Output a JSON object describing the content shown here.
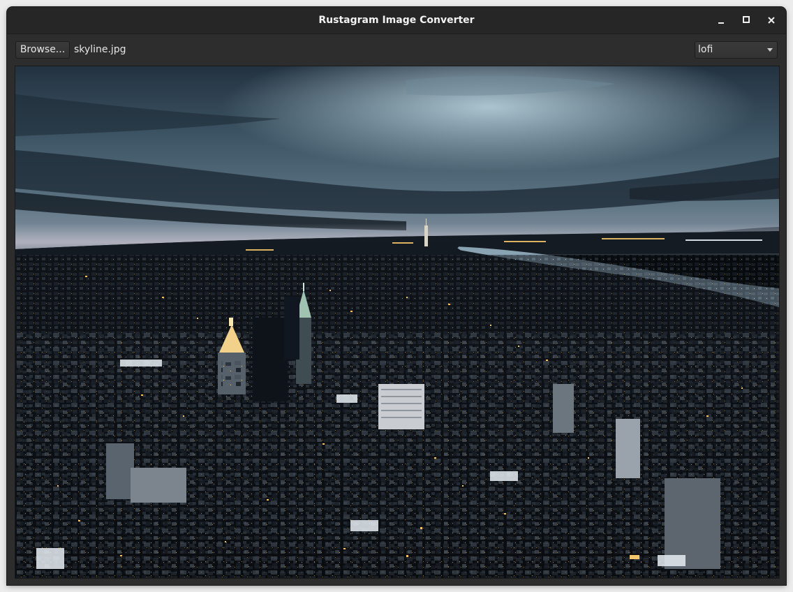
{
  "window": {
    "title": "Rustagram Image Converter"
  },
  "titlebar_buttons": {
    "minimize_icon": "minimize-icon",
    "maximize_icon": "maximize-icon",
    "close_icon": "close-icon"
  },
  "toolbar": {
    "browse_label": "Browse...",
    "filename": "skyline.jpg",
    "filter_selected": "lofi"
  },
  "image": {
    "description_hidden": "",
    "sky_top": "#1c2a36",
    "sky_mid": "#3f5666",
    "sky_light": "#9fb7c4",
    "horizon": "#c9c4cf",
    "water": "#8aa3b3",
    "city_dark": "#0a0c10",
    "light_warm": "#f3c46a",
    "light_white": "#e8eef3"
  }
}
